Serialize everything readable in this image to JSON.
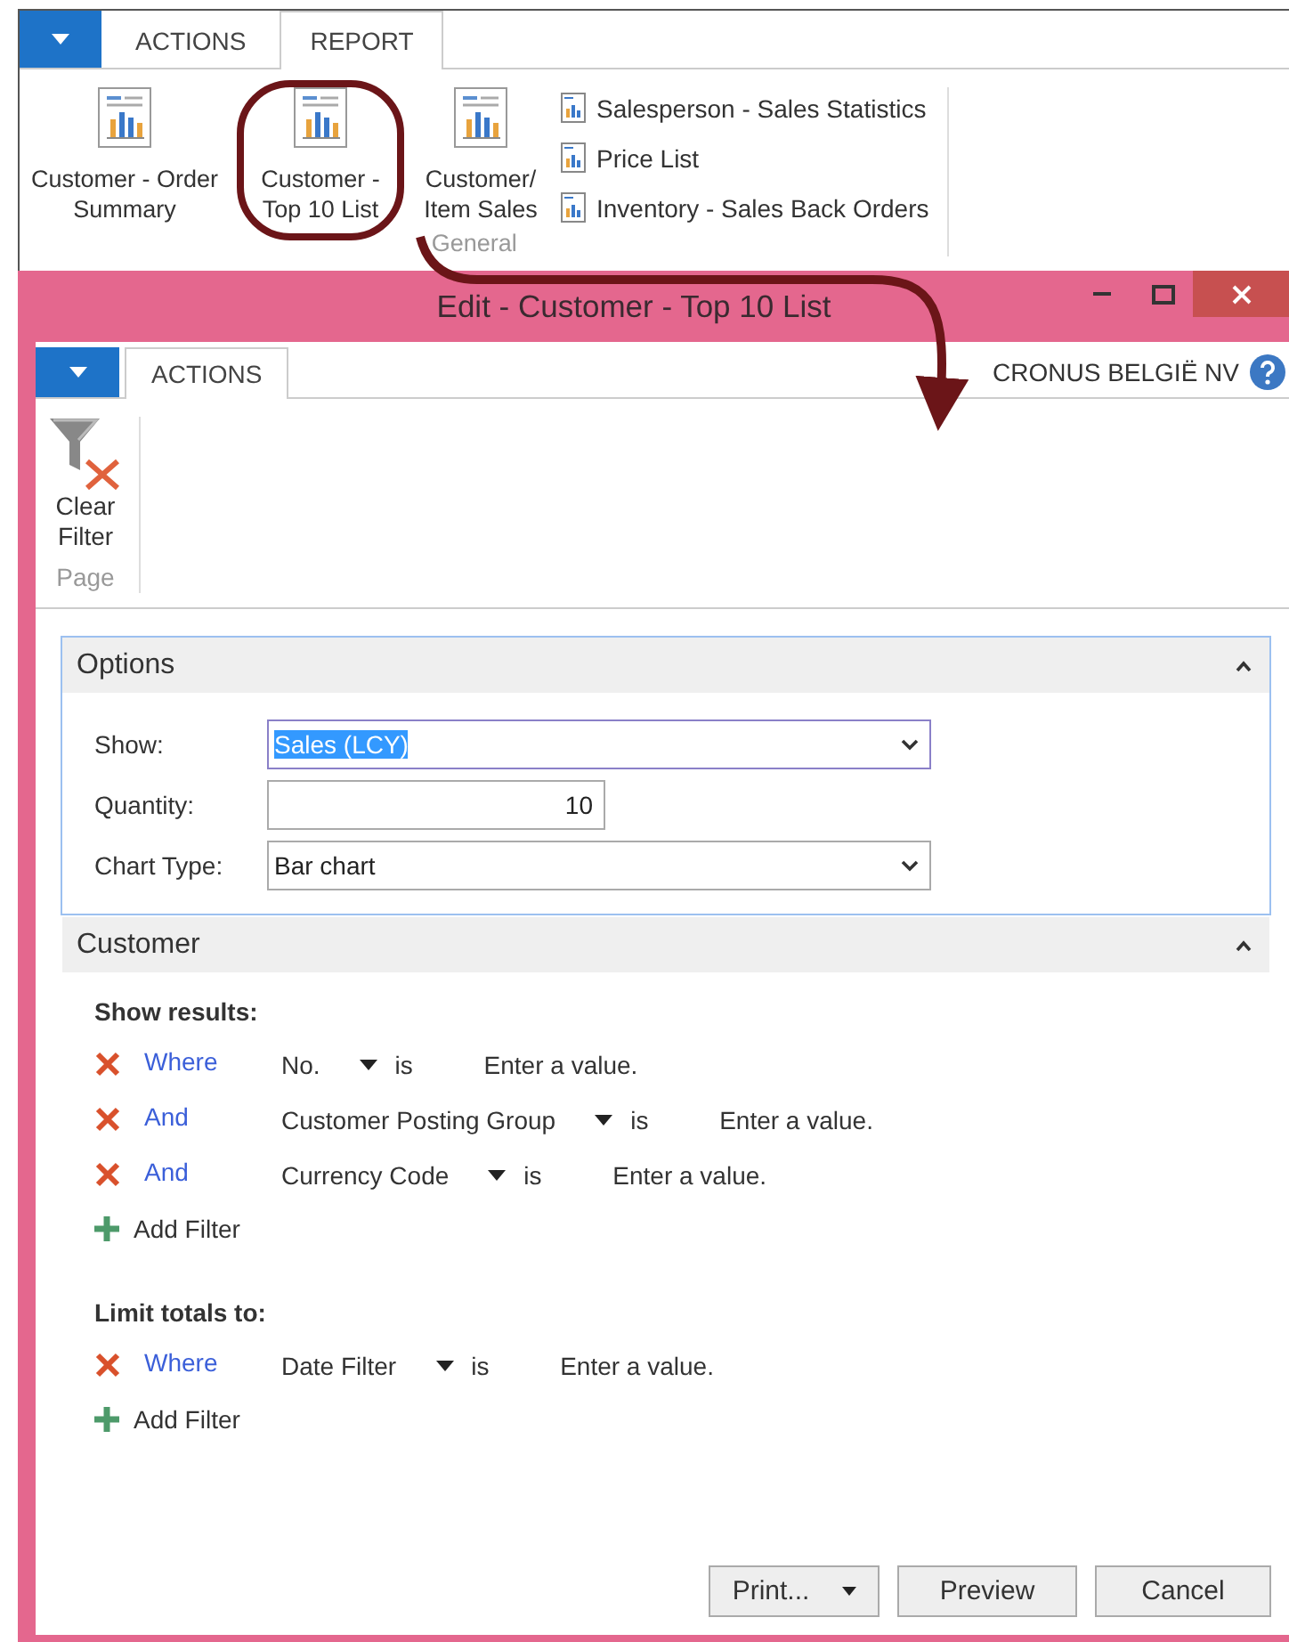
{
  "ribbon": {
    "tabs": [
      {
        "label": "ACTIONS",
        "selected": false
      },
      {
        "label": "REPORT",
        "selected": true
      }
    ],
    "large_buttons": [
      {
        "label": "Customer - Order\nSummary",
        "annotated": false
      },
      {
        "label": "Customer -\nTop 10 List",
        "annotated": true
      },
      {
        "label": "Customer/\nItem Sales",
        "annotated": false
      }
    ],
    "small_buttons": [
      {
        "label": "Salesperson - Sales Statistics"
      },
      {
        "label": "Price List"
      },
      {
        "label": "Inventory - Sales Back Orders"
      }
    ],
    "group": "General"
  },
  "dialog": {
    "title": "Edit - Customer - Top 10 List",
    "tabs": [
      {
        "label": "ACTIONS",
        "selected": true
      }
    ],
    "company": "CRONUS BELGIË NV",
    "actions": [
      {
        "label": "Clear\nFilter"
      }
    ],
    "action_group": "Page",
    "options": {
      "title": "Options",
      "expanded": true,
      "fields": [
        {
          "label": "Show:",
          "kind": "dropdown",
          "value": "Sales (LCY)",
          "selected": true
        },
        {
          "label": "Quantity:",
          "kind": "number",
          "value": "10",
          "selected": false
        },
        {
          "label": "Chart Type:",
          "kind": "dropdown",
          "value": "Bar chart",
          "selected": false
        }
      ]
    },
    "customer": {
      "title": "Customer",
      "expanded": true,
      "sections": [
        {
          "heading": "Show results:",
          "filters": [
            {
              "connector": "Where",
              "field": "No.",
              "operator": "is",
              "placeholder": "Enter a value."
            },
            {
              "connector": "And",
              "field": "Customer Posting Group",
              "operator": "is",
              "placeholder": "Enter a value."
            },
            {
              "connector": "And",
              "field": "Currency Code",
              "operator": "is",
              "placeholder": "Enter a value."
            }
          ],
          "add_label": "Add Filter"
        },
        {
          "heading": "Limit totals to:",
          "filters": [
            {
              "connector": "Where",
              "field": "Date Filter",
              "operator": "is",
              "placeholder": "Enter a value."
            }
          ],
          "add_label": "Add Filter"
        }
      ]
    },
    "buttons": [
      {
        "label": "Print...",
        "dropdown": true
      },
      {
        "label": "Preview",
        "dropdown": false
      },
      {
        "label": "Cancel",
        "dropdown": false
      }
    ]
  }
}
